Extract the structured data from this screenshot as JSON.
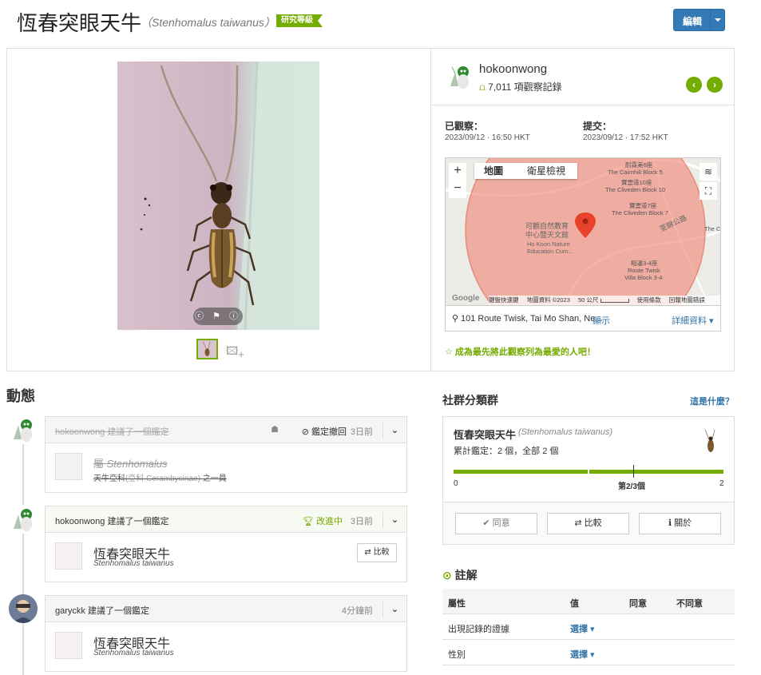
{
  "header": {
    "title": "恆春突眼天牛",
    "scientific_name": "（Stenhomalus taiwanus）",
    "grade_badge": "研究等級",
    "edit_label": "編輯"
  },
  "photo": {
    "controls": "ⓒ ⚑ ⓘ"
  },
  "user": {
    "name": "hokoonwong",
    "obs_count": "7,011 項觀察記錄"
  },
  "dates": {
    "observed_label": "已觀察：",
    "observed_value": "2023/09/12 · 16:50 HKT",
    "submitted_label": "提交：",
    "submitted_value": "2023/09/12 · 17:52 HKT"
  },
  "map": {
    "tab_map": "地圖",
    "tab_satellite": "衛星檢視",
    "zoom_in": "+",
    "zoom_out": "−",
    "labels": [
      "耐霖美6座",
      "The Cairnhill Block 5",
      "寶雲道10座",
      "The Cliveden Block 10",
      "寶雲道7座",
      "The Cliveden Block 7",
      "可觀自然教育",
      "中心暨天文館",
      "Ho Koon Nature",
      "Education Cum...",
      "荃錦公路",
      "相運3-4座",
      "Route Twisk",
      "Villa Block 3-4",
      "The Ca"
    ],
    "attribution": [
      "鍵盤快速鍵",
      "地圖資料 ©2023",
      "50 公尺",
      "使用條款",
      "回報地圖錯誤"
    ],
    "google_label": "Google",
    "location_text": "101 Route Twisk, Tai Mo Shan, Ne...",
    "show_label": "顯示",
    "details_label": "詳細資料 ▾"
  },
  "fav_text": "成為最先將此觀察列為最愛的人吧！",
  "activity": {
    "title": "動態",
    "items": [
      {
        "who": "hokoonwong 建議了一個鑑定",
        "status": "鑑定撤回",
        "time": "3日前",
        "rank": "屬",
        "taxon_name": "Stenhomalus",
        "taxon_sub": "天牛亞科",
        "taxon_sub_sci": "(亞科 Cerambycinae)",
        "taxon_sub_suffix": "之一員"
      },
      {
        "who": "hokoonwong 建議了一個鑑定",
        "status": "改進中",
        "time": "3日前",
        "taxon_name": "恆春突眼天牛",
        "taxon_sci": "Stenhomalus taiwanus",
        "compare": "⇄ 比較"
      },
      {
        "who": "garyckk 建議了一個鑑定",
        "time": "4分鐘前",
        "taxon_name": "恆春突眼天牛",
        "taxon_sci": "Stenhomalus taiwanus"
      }
    ]
  },
  "community": {
    "title": "社群分類群",
    "what": "這是什麼？",
    "name": "恆春突眼天牛",
    "sci": "(Stenhomalus taiwanus)",
    "cumulative": "累計鑑定：2 個，全部 2 個",
    "bar_left": "0",
    "bar_mid": "第2/3個",
    "bar_right": "2",
    "agree": "✔ 同意",
    "compare": "⇄ 比較",
    "about": "ℹ 關於"
  },
  "annotations": {
    "title": "註解",
    "headers": [
      "屬性",
      "值",
      "同意",
      "不同意"
    ],
    "rows": [
      {
        "attr": "出現記錄的證據",
        "value": "選擇 ▾"
      },
      {
        "attr": "性別",
        "value": "選擇 ▾"
      }
    ]
  },
  "colors": {
    "accent": "#74ac00",
    "link": "#3374a8",
    "primary": "#337ab7"
  }
}
